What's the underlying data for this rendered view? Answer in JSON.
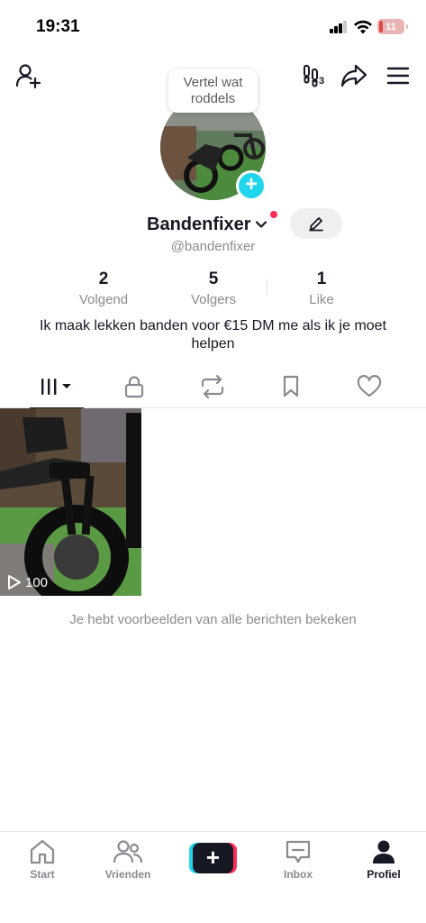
{
  "status_bar": {
    "time": "19:31",
    "battery": "11",
    "battery_color": "#e04848"
  },
  "top_nav": {
    "icons": [
      "add-friend-icon",
      "footsteps-icon",
      "share-icon",
      "menu-icon"
    ],
    "footsteps_count": "3"
  },
  "profile": {
    "note_bubble": "Vertel wat roddels",
    "username": "Bandenfixer",
    "handle": "@bandenfixer",
    "bio": "Ik maak lekken banden voor €15 DM me als ik je moet helpen",
    "stats": [
      {
        "value": "2",
        "label": "Volgend"
      },
      {
        "value": "5",
        "label": "Volgers"
      },
      {
        "value": "1",
        "label": "Like"
      }
    ]
  },
  "tabs": [
    "videos-grid-icon",
    "lock-icon",
    "repost-icon",
    "bookmark-icon",
    "heart-icon"
  ],
  "videos": [
    {
      "views": "100"
    }
  ],
  "end_message": "Je hebt voorbeelden van alle berichten bekeken",
  "bottom_nav": {
    "items": [
      {
        "label": "Start"
      },
      {
        "label": "Vrienden"
      },
      {
        "label": "Inbox"
      },
      {
        "label": "Profiel"
      }
    ],
    "accent_cyan": "#20d5ec",
    "accent_pink": "#fe2c55"
  }
}
